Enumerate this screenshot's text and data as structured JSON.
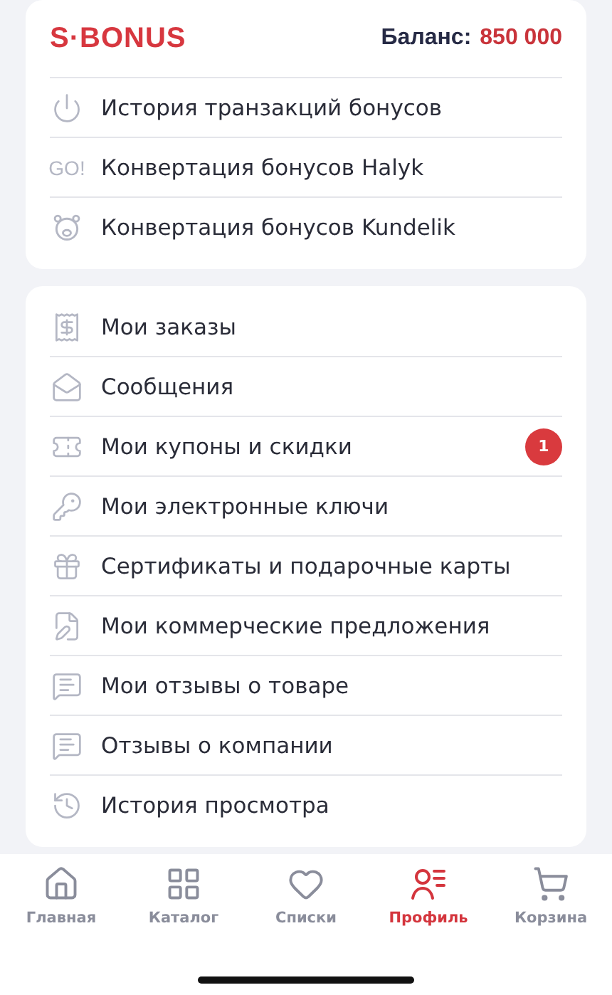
{
  "header": {
    "logo": "S·BONUS",
    "balance_label": "Баланс:",
    "balance_value": "850 000"
  },
  "bonus_menu": [
    {
      "label": "История транзакций бонусов"
    },
    {
      "label": "Конвертация бонусов Halyk",
      "icon_text": "GO!"
    },
    {
      "label": "Конвертация бонусов Kundelik"
    }
  ],
  "account_menu": [
    {
      "label": "Мои заказы"
    },
    {
      "label": "Сообщения"
    },
    {
      "label": "Мои купоны и скидки",
      "badge": "1"
    },
    {
      "label": "Мои электронные ключи"
    },
    {
      "label": "Сертификаты и подарочные карты"
    },
    {
      "label": "Мои коммерческие предложения"
    },
    {
      "label": "Мои отзывы о товаре"
    },
    {
      "label": "Отзывы о компании"
    },
    {
      "label": "История просмотра"
    }
  ],
  "tab_bar": [
    {
      "label": "Главная",
      "selected": false
    },
    {
      "label": "Каталог",
      "selected": false
    },
    {
      "label": "Списки",
      "selected": false
    },
    {
      "label": "Профиль",
      "selected": true
    },
    {
      "label": "Корзина",
      "selected": false
    }
  ]
}
